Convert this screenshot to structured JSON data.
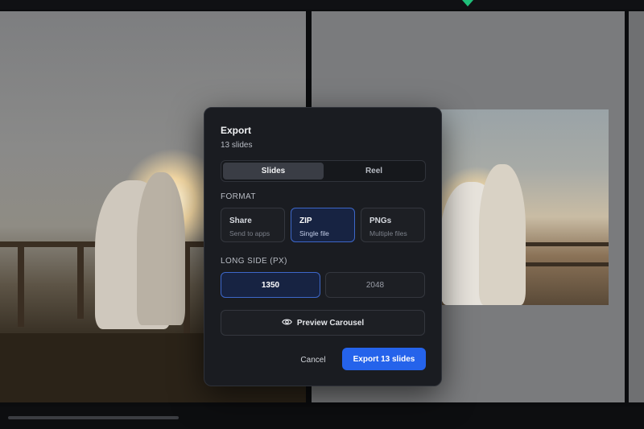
{
  "dialog": {
    "title": "Export",
    "subtitle": "13 slides",
    "mode_tabs": [
      {
        "label": "Slides",
        "active": true
      },
      {
        "label": "Reel",
        "active": false
      }
    ],
    "format_label": "FORMAT",
    "formats": [
      {
        "name": "Share",
        "desc": "Send to apps",
        "selected": false
      },
      {
        "name": "ZIP",
        "desc": "Single file",
        "selected": true
      },
      {
        "name": "PNGs",
        "desc": "Multiple files",
        "selected": false
      }
    ],
    "long_side_label": "LONG SIDE (PX)",
    "sizes": [
      {
        "label": "1350",
        "selected": true
      },
      {
        "label": "2048",
        "selected": false
      }
    ],
    "preview_label": "Preview Carousel",
    "cancel_label": "Cancel",
    "export_label": "Export 13 slides"
  },
  "icons": {
    "preview": "eye-icon",
    "marker": "triangle-down-icon"
  },
  "colors": {
    "accent": "#2563eb",
    "selected_border": "#3d67c9",
    "marker": "#1fbf7a"
  }
}
